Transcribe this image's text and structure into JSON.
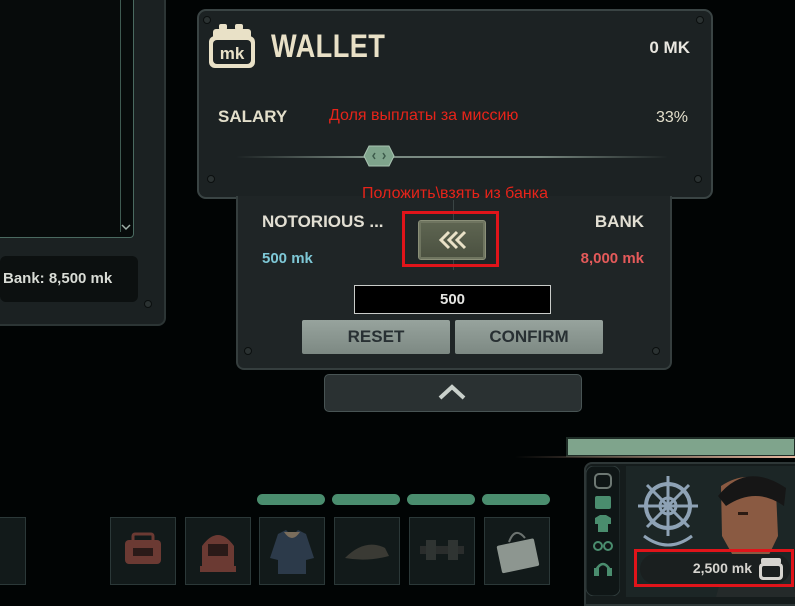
{
  "left_panel": {
    "bank_text": "Bank: 8,500 mk"
  },
  "wallet": {
    "title": "WALLET",
    "logo_text": "mk",
    "amount": "0 MK",
    "salary_label": "SALARY",
    "salary_annotation": "Доля выплаты за миссию",
    "salary_percent": "33%",
    "salary_fraction": 0.33
  },
  "transfer": {
    "annotation": "Положить\\взять из банка",
    "left_name": "NOTORIOUS ...",
    "left_amount": "500 mk",
    "right_name": "BANK",
    "right_amount": "8,000 mk",
    "input_value": "500",
    "reset_label": "RESET",
    "confirm_label": "CONFIRM"
  },
  "character": {
    "money": "2,500 mk"
  },
  "colors": {
    "accent_green": "#4a8d6e",
    "annotation_red": "#e0141a",
    "bank_red": "#e45a5a",
    "player_cyan": "#7ec8d6"
  }
}
